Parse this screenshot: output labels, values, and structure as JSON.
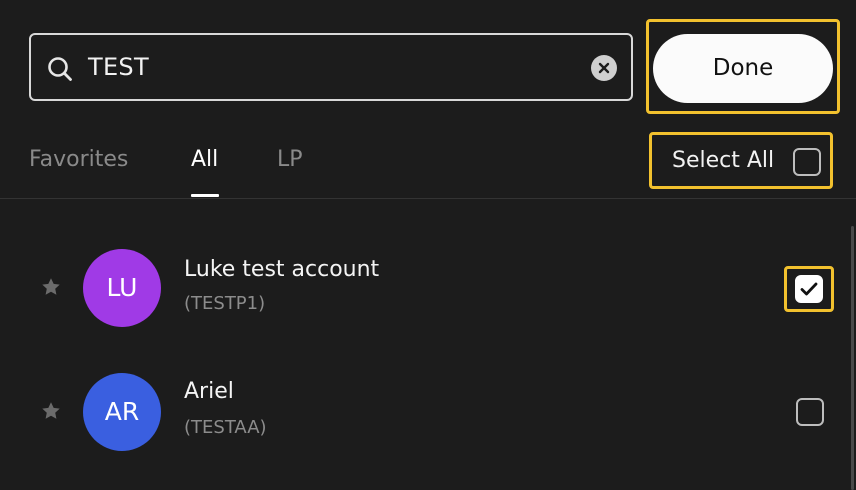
{
  "search": {
    "value": "TEST"
  },
  "header": {
    "done_label": "Done",
    "select_all_label": "Select All",
    "select_all_checked": false
  },
  "tabs": [
    {
      "label": "Favorites",
      "active": false
    },
    {
      "label": "All",
      "active": true
    },
    {
      "label": "LP",
      "active": false
    }
  ],
  "accounts": [
    {
      "initials": "LU",
      "name": "Luke test account",
      "code": "(TESTP1)",
      "avatar_color": "#a03ae6",
      "checked": true
    },
    {
      "initials": "AR",
      "name": "Ariel",
      "code": "(TESTAA)",
      "avatar_color": "#3a5fe0",
      "checked": false
    }
  ],
  "colors": {
    "background": "#1c1c1c",
    "highlight": "#f2c12e"
  }
}
